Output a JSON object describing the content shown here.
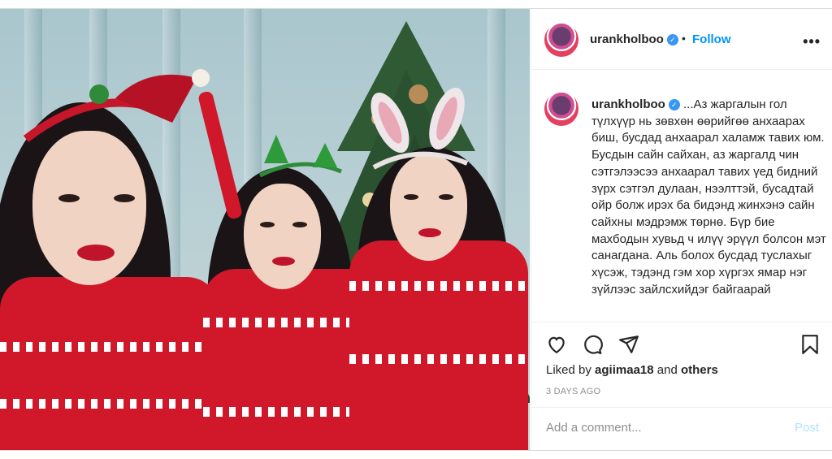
{
  "post": {
    "username": "urankholboo",
    "separator": "•",
    "follow_label": "Follow",
    "more_label": "•••",
    "caption_username": "urankholboo",
    "caption_text": "...Аз жаргалын гол түлхүүр нь зөвхөн өөрийгөө анхаарах биш, бусдад анхаарал халамж тавих юм. Бусдын сайн сайхан, аз жаргалд чин сэтгэлээсээ анхаарал тавих үед бидний зүрх сэтгэл дулаан, нээлттэй, бусадтай ойр болж ирэх ба бидэнд жинхэнэ сайн сайхны мэдрэмж төрнө. Бүр бие махбодын хувьд ч илүү эрүүл болсон мэт санагдана. Аль болох бусдад туслахыг хүсэж, тэдэнд гэм хор хүргэх ямар нэг зүйлээс зайлсхийдэг байгаарай",
    "liked_prefix": "Liked by",
    "liked_user": "agiimaa18",
    "liked_and": "and",
    "liked_others": "others",
    "timestamp": "3 DAYS AGO",
    "comment_placeholder": "Add a comment...",
    "post_label": "Post"
  },
  "icons": {
    "like": "heart-icon",
    "comment": "comment-icon",
    "share": "share-icon",
    "save": "bookmark-icon",
    "verified": "verified-badge-icon"
  },
  "colors": {
    "link_blue": "#0095f6",
    "post_disabled": "#b2dffc",
    "verified": "#3897f0",
    "sweater_red": "#d0182a"
  }
}
